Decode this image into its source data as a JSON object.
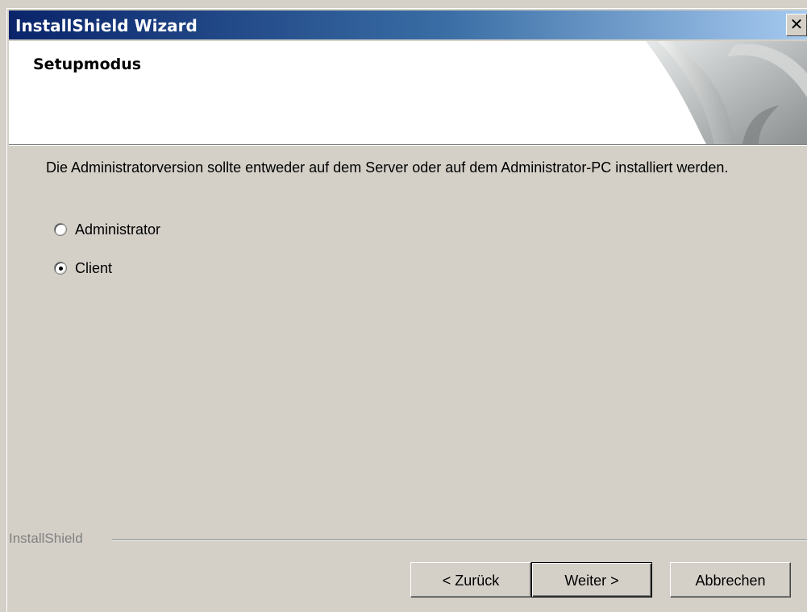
{
  "window": {
    "title": "InstallShield Wizard",
    "close_glyph": "✕"
  },
  "header": {
    "title": "Setupmodus"
  },
  "main": {
    "description": "Die Administratorversion sollte entweder auf dem Server oder auf dem Administrator-PC installiert werden.",
    "options": [
      {
        "label": "Administrator",
        "selected": false
      },
      {
        "label": "Client",
        "selected": true
      }
    ]
  },
  "footer": {
    "brand": "InstallShield",
    "back_label": "< Zurück",
    "next_label": "Weiter >",
    "cancel_label": "Abbrechen"
  },
  "colors": {
    "title_gradient_start": "#0a246a",
    "title_gradient_end": "#a6caf0",
    "dialog_bg": "#d4d0c8"
  }
}
